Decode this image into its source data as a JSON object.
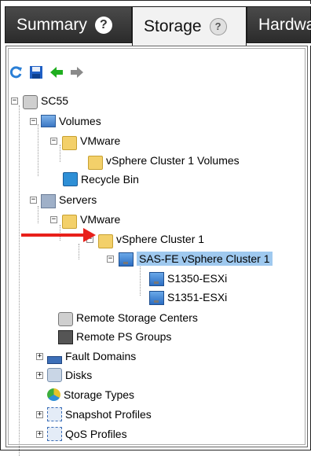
{
  "tabs": [
    {
      "label": "Summary",
      "help": "?"
    },
    {
      "label": "Storage",
      "help": "?"
    },
    {
      "label": "Hardwa",
      "help": ""
    }
  ],
  "toolbar": {
    "icons": [
      "refresh-icon",
      "save-icon",
      "back-arrow-icon",
      "forward-arrow-icon"
    ]
  },
  "tree": {
    "root": "SC55",
    "volumes": "Volumes",
    "volumes_vmware": "VMware",
    "vsphere_volumes": "vSphere Cluster 1 Volumes",
    "recycle_bin": "Recycle Bin",
    "servers": "Servers",
    "servers_vmware": "VMware",
    "vsphere_cluster": "vSphere Cluster 1",
    "sas_cluster": "SAS-FE vSphere Cluster 1",
    "host1": "S1350-ESXi",
    "host2": "S1351-ESXi",
    "remote_storage": "Remote Storage Centers",
    "remote_ps": "Remote PS Groups",
    "fault_domains": "Fault Domains",
    "disks": "Disks",
    "storage_types": "Storage Types",
    "snapshot_profiles": "Snapshot Profiles",
    "qos_profiles": "QoS Profiles"
  },
  "colors": {
    "selection": "#9fc9ef",
    "annotation_arrow": "#e8201a",
    "tab_dark": "#333333"
  }
}
